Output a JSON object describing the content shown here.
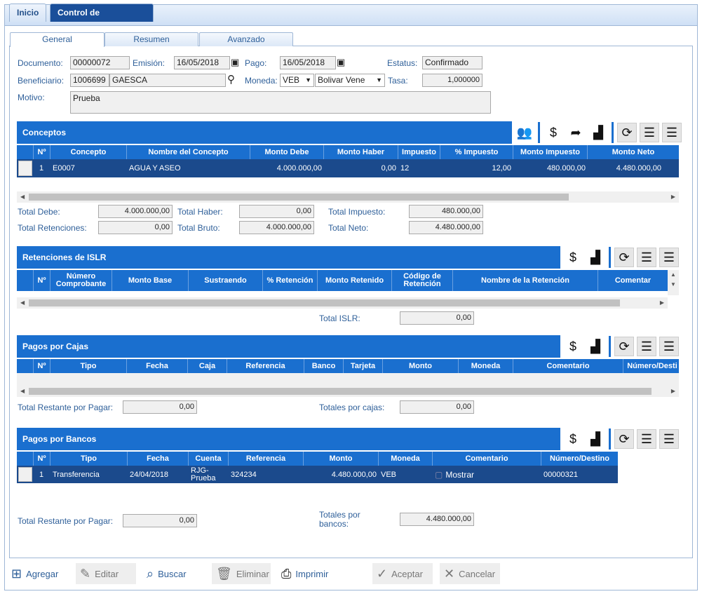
{
  "tabs": {
    "home": "Inicio",
    "active": "Control de Egresos",
    "close": "×"
  },
  "subtabs": [
    "General",
    "Resumen",
    "Avanzado"
  ],
  "header": {
    "documento_label": "Documento:",
    "documento": "00000072",
    "emision_label": "Emisión:",
    "emision": "16/05/2018",
    "pago_label": "Pago:",
    "pago": "16/05/2018",
    "estatus_label": "Estatus:",
    "estatus": "Confirmado",
    "beneficiario_label": "Beneficiario:",
    "beneficiario_code": "1006699",
    "beneficiario_name": "GAESCA",
    "moneda_label": "Moneda:",
    "moneda_code": "VEB",
    "moneda_name": "Bolivar Vene",
    "tasa_label": "Tasa:",
    "tasa": "1,000000",
    "motivo_label": "Motivo:",
    "motivo": "Prueba"
  },
  "conceptos": {
    "title": "Conceptos",
    "columns": [
      "Nº",
      "Concepto",
      "Nombre del Concepto",
      "Monto Debe",
      "Monto Haber",
      "Impuesto",
      "% Impuesto",
      "Monto Impuesto",
      "Monto Neto"
    ],
    "rows": [
      [
        "1",
        "E0007",
        "AGUA Y ASEO",
        "4.000.000,00",
        "0,00",
        "12",
        "12,00",
        "480.000,00",
        "4.480.000,00"
      ]
    ],
    "totals": {
      "debe_label": "Total Debe:",
      "debe": "4.000.000,00",
      "haber_label": "Total Haber:",
      "haber": "0,00",
      "impuesto_label": "Total Impuesto:",
      "impuesto": "480.000,00",
      "retenciones_label": "Total Retenciones:",
      "retenciones": "0,00",
      "bruto_label": "Total Bruto:",
      "bruto": "4.000.000,00",
      "neto_label": "Total Neto:",
      "neto": "4.480.000,00"
    }
  },
  "islr": {
    "title": "Retenciones de ISLR",
    "columns": [
      "Nº",
      "Número Comprobante",
      "Monto Base",
      "Sustraendo",
      "% Retención",
      "Monto Retenido",
      "Código de Retención",
      "Nombre de la Retención",
      "Comentar"
    ],
    "total_label": "Total ISLR:",
    "total": "0,00"
  },
  "cajas": {
    "title": "Pagos por Cajas",
    "columns": [
      "Nº",
      "Tipo",
      "Fecha",
      "Caja",
      "Referencia",
      "Banco",
      "Tarjeta",
      "Monto",
      "Moneda",
      "Comentario",
      "Número/Desti"
    ],
    "restante_label": "Total Restante por Pagar:",
    "restante": "0,00",
    "totales_label": "Totales por cajas:",
    "totales": "0,00"
  },
  "bancos": {
    "title": "Pagos por Bancos",
    "columns": [
      "Nº",
      "Tipo",
      "Fecha",
      "Cuenta",
      "Referencia",
      "Monto",
      "Moneda",
      "Comentario",
      "Número/Destino"
    ],
    "rows": [
      [
        "1",
        "Transferencia",
        "24/04/2018",
        "RJG-Prueba",
        "324234",
        "4.480.000,00",
        "VEB",
        "Mostrar",
        "00000321"
      ]
    ],
    "restante_label": "Total Restante por Pagar:",
    "restante": "0,00",
    "totales_label": "Totales por bancos:",
    "totales": "4.480.000,00"
  },
  "buttons": {
    "agregar": "Agregar",
    "editar": "Editar",
    "buscar": "Buscar",
    "eliminar": "Eliminar",
    "imprimir": "Imprimir",
    "aceptar": "Aceptar",
    "cancelar": "Cancelar"
  },
  "colors": {
    "header_blue": "#1a6fcf",
    "row_dark": "#1b4a8c",
    "label_blue": "#2e5f99"
  }
}
